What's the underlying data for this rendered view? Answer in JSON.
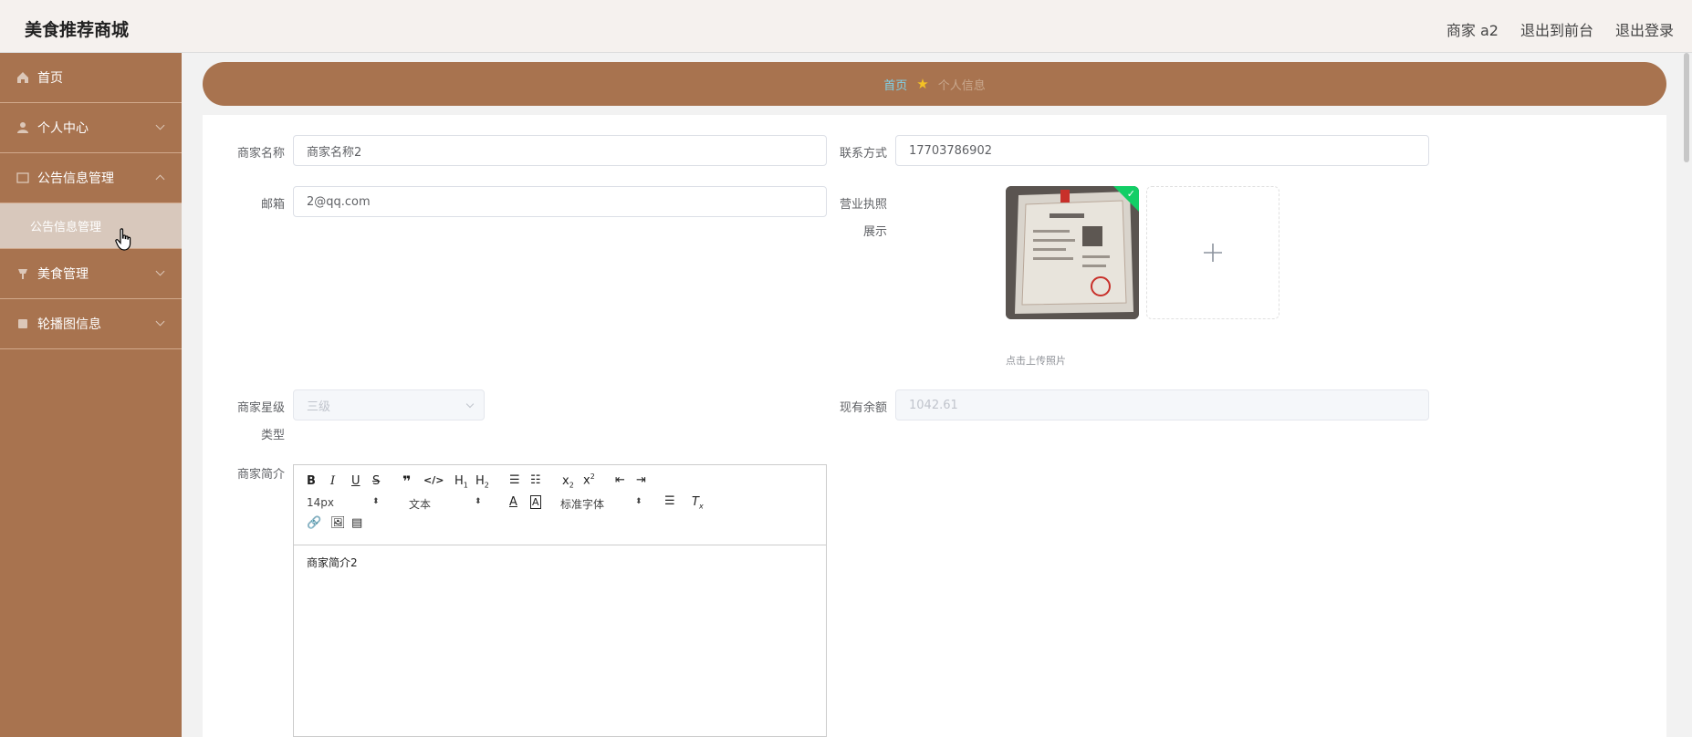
{
  "header": {
    "brand": "美食推荐商城",
    "user_label": "商家 a2",
    "to_front_label": "退出到前台",
    "logout_label": "退出登录"
  },
  "sidebar": {
    "items": [
      {
        "label": "首页",
        "icon": "home-icon"
      },
      {
        "label": "个人中心",
        "icon": "user-icon"
      },
      {
        "label": "公告信息管理",
        "icon": "notice-icon"
      },
      {
        "label": "公告信息管理",
        "icon": ""
      },
      {
        "label": "美食管理",
        "icon": "food-icon"
      },
      {
        "label": "轮播图信息",
        "icon": "carousel-icon"
      }
    ]
  },
  "breadcrumb": {
    "home": "首页",
    "current": "个人信息"
  },
  "form": {
    "shop_name_label": "商家名称",
    "shop_name_value": "商家名称2",
    "contact_label": "联系方式",
    "contact_value": "17703786902",
    "email_label": "邮箱",
    "email_value": "2@qq.com",
    "license_label_1": "营业执照",
    "license_label_2": "展示",
    "upload_hint": "点击上传照片",
    "star_label_1": "商家星级",
    "star_label_2": "类型",
    "star_value": "三级",
    "balance_label": "现有余额",
    "balance_value": "1042.61",
    "intro_label": "商家简介",
    "intro_value": "商家简介2"
  },
  "editor": {
    "font_size": "14px",
    "text_type": "文本",
    "font_family": "标准字体"
  },
  "colors": {
    "sidebar_bg": "#a8734f",
    "breadcrumb_bg": "#a8734f",
    "header_bg": "#f5f1ee",
    "breadcrumb_home": "#7fd1e8",
    "upload_ok": "#13ce66"
  }
}
